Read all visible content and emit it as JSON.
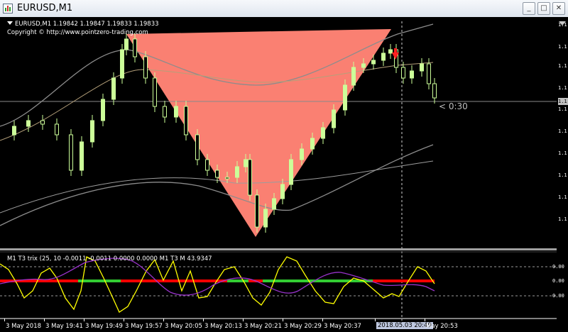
{
  "window": {
    "title": "EURUSD,M1",
    "buttons": {
      "minimize": "_",
      "maximize": "□",
      "close": "✕"
    }
  },
  "chart": {
    "symbol_line": "EURUSD,M1  1.19842 1.19847 1.19833 1.19833",
    "copyright": "Copyright © http://www.pointzero-trading.com",
    "countdown": "< 0:30",
    "price_labels": [
      "1.1",
      "1.1",
      "1.1",
      "1.1",
      "1.1",
      "1.1",
      "1.1",
      "1.1",
      "1.1",
      "1.1"
    ],
    "current_price_label": "1.1",
    "colors": {
      "background": "#000000",
      "bull_candle": "#ccff99",
      "bear_candle": "#ccff99",
      "pattern_fill": "#fa8072",
      "moving_average": "#8c8c8c",
      "signal_arrow": "#ff2020"
    }
  },
  "indicator": {
    "label": "M1 T3 trix (25, 10 -0.0011 -0.0011 0.0000 0.0000  M1  T3 M",
    "value": "43.9347",
    "scale_labels": [
      "0.00",
      "0.00",
      "0.00"
    ],
    "colors": {
      "trix": "#ffff00",
      "signal": "#9932cc",
      "up_bar": "#33cc33",
      "down_bar": "#ff0000"
    }
  },
  "time_axis": {
    "labels": [
      "3 May 2018",
      "3 May 19:41",
      "3 May 19:49",
      "3 May 19:57",
      "3 May 20:05",
      "3 May 20:13",
      "3 May 20:21",
      "3 May 20:29",
      "3 May 20:37",
      "2018.05.03 20:49",
      "May 20:53"
    ],
    "highlighted_index": 9
  }
}
